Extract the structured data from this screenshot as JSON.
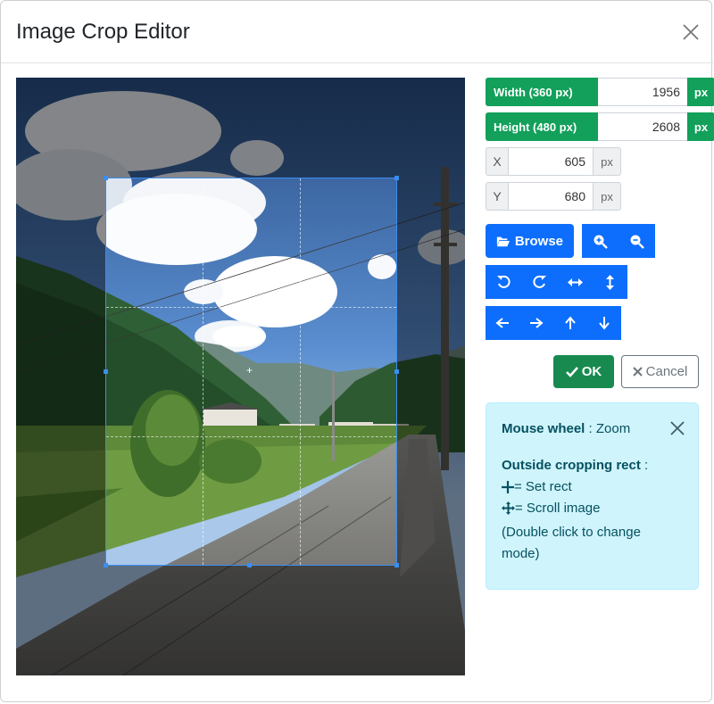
{
  "dialog": {
    "title": "Image Crop Editor"
  },
  "fields": {
    "width": {
      "label": "Width (360 px)",
      "value": "1956",
      "unit": "px"
    },
    "height": {
      "label": "Height (480 px)",
      "value": "2608",
      "unit": "px"
    },
    "x": {
      "label": "X",
      "value": "605",
      "unit": "px"
    },
    "y": {
      "label": "Y",
      "value": "680",
      "unit": "px"
    }
  },
  "toolbar": {
    "browse_label": "Browse",
    "ok_label": "OK",
    "cancel_label": "Cancel"
  },
  "help": {
    "wheel_label": "Mouse wheel",
    "wheel_value": " : Zoom",
    "outside_title": "Outside cropping rect",
    "outside_colon": " :",
    "set_rect": " = Set rect",
    "scroll_image": " = Scroll image",
    "double_click": "(Double click to change mode)"
  },
  "colors": {
    "primary": "#0d6efd",
    "success": "#188a4f",
    "green_label": "#12a05a",
    "info_bg": "#cff4fc",
    "crop_border": "#3b8df0"
  },
  "icons": [
    "close-icon",
    "folder-open-icon",
    "zoom-in-icon",
    "zoom-out-icon",
    "rotate-left-icon",
    "rotate-right-icon",
    "flip-horizontal-icon",
    "flip-vertical-icon",
    "arrow-left-icon",
    "arrow-right-icon",
    "arrow-up-icon",
    "arrow-down-icon",
    "check-icon",
    "x-icon",
    "crosshair-icon",
    "move-icon"
  ]
}
